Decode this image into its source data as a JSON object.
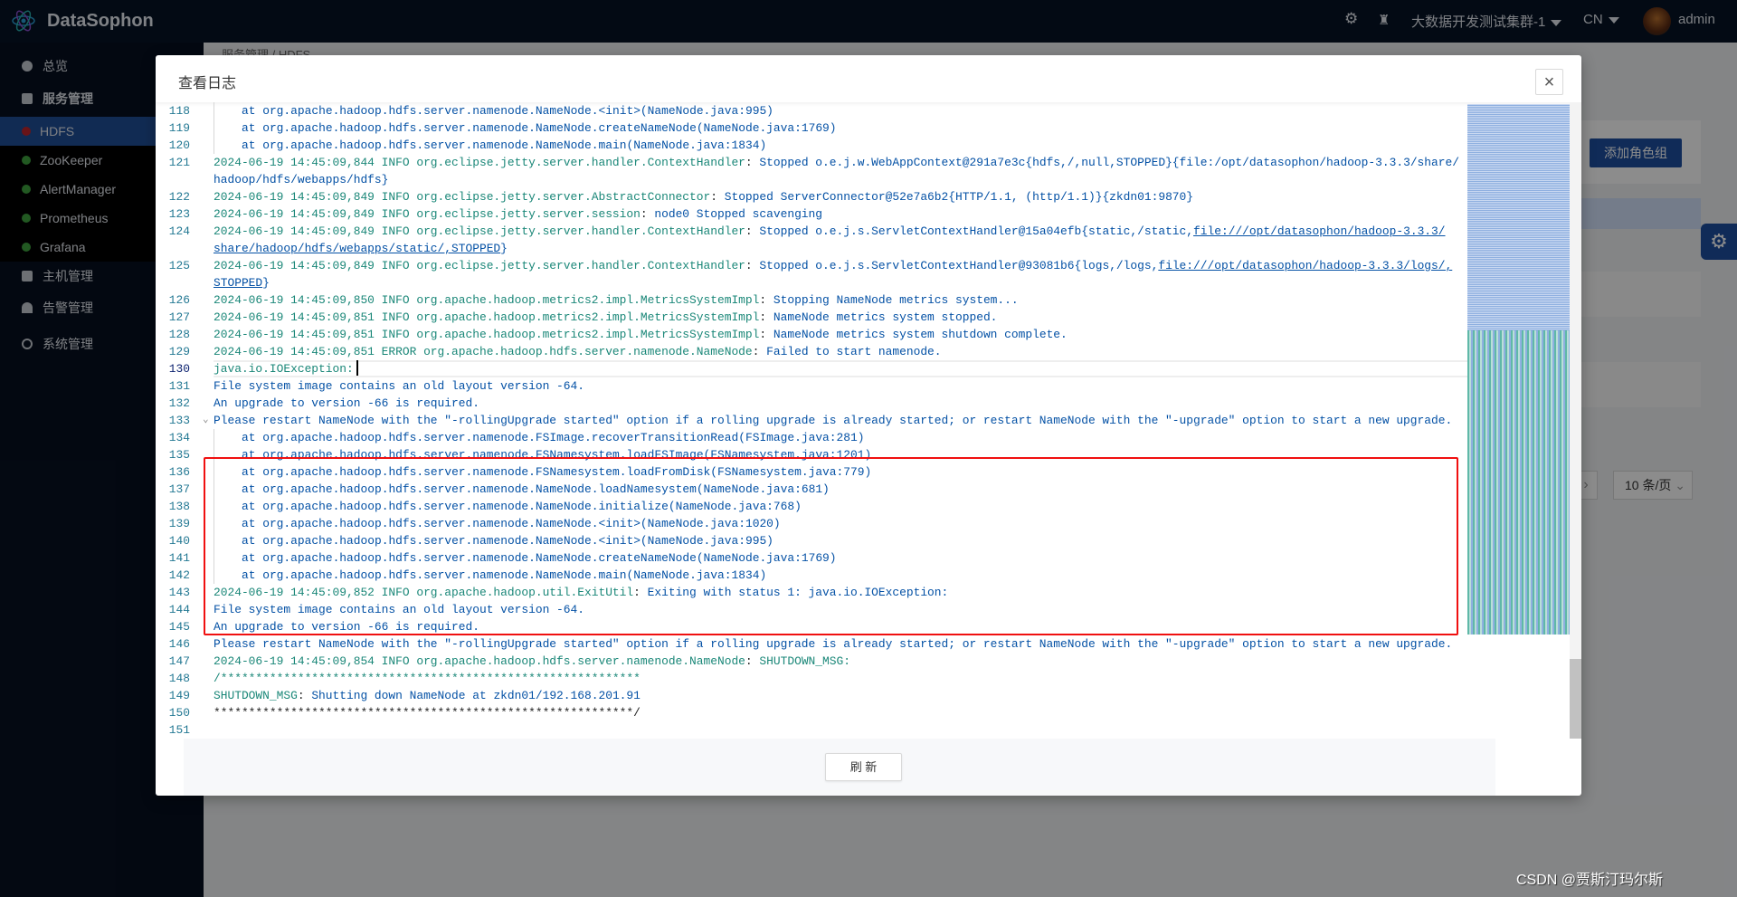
{
  "app": {
    "brand": "DataSophon",
    "cluster": "大数据开发测试集群-1",
    "lang": "CN",
    "user": "admin"
  },
  "sidebar": {
    "items": [
      {
        "label": "总览",
        "icon": "pie-chart-icon"
      },
      {
        "label": "服务管理",
        "icon": "apps-icon"
      },
      {
        "label": "HDFS",
        "status": "red"
      },
      {
        "label": "ZooKeeper",
        "status": "green"
      },
      {
        "label": "AlertManager",
        "status": "green"
      },
      {
        "label": "Prometheus",
        "status": "green"
      },
      {
        "label": "Grafana",
        "status": "green"
      },
      {
        "label": "主机管理",
        "icon": "server-icon"
      },
      {
        "label": "告警管理",
        "icon": "alarm-icon"
      },
      {
        "label": "系统管理",
        "icon": "gear-icon"
      }
    ]
  },
  "background": {
    "breadcrumb": "服务管理  /  HDFS",
    "add_role_group": "添加角色组",
    "page_size": "10 条/页"
  },
  "modal": {
    "title": "查看日志",
    "close": "×",
    "refresh": "刷 新"
  },
  "log": [
    {
      "n": 118,
      "ind": true,
      "s": [
        [
          "b",
          "at org.apache.hadoop.hdfs.server.namenode.NameNode.<init>(NameNode.java:995)"
        ]
      ]
    },
    {
      "n": 119,
      "ind": true,
      "s": [
        [
          "b",
          "at org.apache.hadoop.hdfs.server.namenode.NameNode.createNameNode(NameNode.java:1769)"
        ]
      ]
    },
    {
      "n": 120,
      "ind": true,
      "s": [
        [
          "b",
          "at org.apache.hadoop.hdfs.server.namenode.NameNode.main(NameNode.java:1834)"
        ]
      ]
    },
    {
      "n": 121,
      "s": [
        [
          "t",
          "2024-06-19 14:45:09,844 INFO org.eclipse.jetty.server.handler.ContextHandler"
        ],
        [
          "k",
          ": "
        ],
        [
          "b",
          "Stopped o.e.j.w.WebAppContext@291a7e3c{hdfs,/,null,STOPPED}{file:/opt/datasophon/hadoop-3.3.3/share/"
        ],
        [
          "br",
          ""
        ],
        [
          "b",
          "hadoop/hdfs/webapps/hdfs}"
        ]
      ]
    },
    {
      "n": 122,
      "s": [
        [
          "t",
          "2024-06-19 14:45:09,849 INFO org.eclipse.jetty.server.AbstractConnector"
        ],
        [
          "k",
          ": "
        ],
        [
          "b",
          "Stopped ServerConnector@52e7a6b2{HTTP/1.1, (http/1.1)}{zkdn01:9870}"
        ]
      ]
    },
    {
      "n": 123,
      "s": [
        [
          "t",
          "2024-06-19 14:45:09,849 INFO org.eclipse.jetty.server.session"
        ],
        [
          "k",
          ": "
        ],
        [
          "b",
          "node0 Stopped scavenging"
        ]
      ]
    },
    {
      "n": 124,
      "s": [
        [
          "t",
          "2024-06-19 14:45:09,849 INFO org.eclipse.jetty.server.handler.ContextHandler"
        ],
        [
          "k",
          ": "
        ],
        [
          "b",
          "Stopped o.e.j.s.ServletContextHandler@15a04efb{static,/static,"
        ],
        [
          "l",
          "file:///opt/datasophon/hadoop-3.3.3/"
        ],
        [
          "br",
          ""
        ],
        [
          "l",
          "share/hadoop/hdfs/webapps/static/,STOPPED"
        ],
        [
          "b",
          "}"
        ]
      ]
    },
    {
      "n": 125,
      "s": [
        [
          "t",
          "2024-06-19 14:45:09,849 INFO org.eclipse.jetty.server.handler.ContextHandler"
        ],
        [
          "k",
          ": "
        ],
        [
          "b",
          "Stopped o.e.j.s.ServletContextHandler@93081b6{logs,/logs,"
        ],
        [
          "l",
          "file:///opt/datasophon/hadoop-3.3.3/logs/,"
        ],
        [
          "br",
          ""
        ],
        [
          "l",
          "STOPPED"
        ],
        [
          "b",
          "}"
        ]
      ]
    },
    {
      "n": 126,
      "s": [
        [
          "t",
          "2024-06-19 14:45:09,850 INFO org.apache.hadoop.metrics2.impl.MetricsSystemImpl"
        ],
        [
          "k",
          ": "
        ],
        [
          "b",
          "Stopping NameNode metrics system..."
        ]
      ]
    },
    {
      "n": 127,
      "s": [
        [
          "t",
          "2024-06-19 14:45:09,851 INFO org.apache.hadoop.metrics2.impl.MetricsSystemImpl"
        ],
        [
          "k",
          ": "
        ],
        [
          "b",
          "NameNode metrics system stopped."
        ]
      ]
    },
    {
      "n": 128,
      "s": [
        [
          "t",
          "2024-06-19 14:45:09,851 INFO org.apache.hadoop.metrics2.impl.MetricsSystemImpl"
        ],
        [
          "k",
          ": "
        ],
        [
          "b",
          "NameNode metrics system shutdown complete."
        ]
      ]
    },
    {
      "n": 129,
      "s": [
        [
          "t",
          "2024-06-19 14:45:09,851 ERROR org.apache.hadoop.hdfs.server.namenode.NameNode"
        ],
        [
          "k",
          ": "
        ],
        [
          "b",
          "Failed to start namenode."
        ]
      ]
    },
    {
      "n": 130,
      "cur": true,
      "s": [
        [
          "t",
          "java.io.IOException:"
        ]
      ]
    },
    {
      "n": 131,
      "s": [
        [
          "b",
          "File system image contains an old layout version -64."
        ]
      ]
    },
    {
      "n": 132,
      "s": [
        [
          "b",
          "An upgrade to version -66 is required."
        ]
      ]
    },
    {
      "n": 133,
      "fold": true,
      "s": [
        [
          "b",
          "Please restart NameNode with the \"-rollingUpgrade started\" option if a rolling upgrade is already started; or restart NameNode with the \"-upgrade\" option to start a new upgrade."
        ]
      ]
    },
    {
      "n": 134,
      "ind": true,
      "s": [
        [
          "b",
          "at org.apache.hadoop.hdfs.server.namenode.FSImage.recoverTransitionRead(FSImage.java:281)"
        ]
      ]
    },
    {
      "n": 135,
      "ind": true,
      "s": [
        [
          "b",
          "at org.apache.hadoop.hdfs.server.namenode.FSNamesystem.loadFSImage(FSNamesystem.java:1201)"
        ]
      ]
    },
    {
      "n": 136,
      "ind": true,
      "s": [
        [
          "b",
          "at org.apache.hadoop.hdfs.server.namenode.FSNamesystem.loadFromDisk(FSNamesystem.java:779)"
        ]
      ]
    },
    {
      "n": 137,
      "ind": true,
      "s": [
        [
          "b",
          "at org.apache.hadoop.hdfs.server.namenode.NameNode.loadNamesystem(NameNode.java:681)"
        ]
      ]
    },
    {
      "n": 138,
      "ind": true,
      "s": [
        [
          "b",
          "at org.apache.hadoop.hdfs.server.namenode.NameNode.initialize(NameNode.java:768)"
        ]
      ]
    },
    {
      "n": 139,
      "ind": true,
      "s": [
        [
          "b",
          "at org.apache.hadoop.hdfs.server.namenode.NameNode.<init>(NameNode.java:1020)"
        ]
      ]
    },
    {
      "n": 140,
      "ind": true,
      "s": [
        [
          "b",
          "at org.apache.hadoop.hdfs.server.namenode.NameNode.<init>(NameNode.java:995)"
        ]
      ]
    },
    {
      "n": 141,
      "ind": true,
      "s": [
        [
          "b",
          "at org.apache.hadoop.hdfs.server.namenode.NameNode.createNameNode(NameNode.java:1769)"
        ]
      ]
    },
    {
      "n": 142,
      "ind": true,
      "s": [
        [
          "b",
          "at org.apache.hadoop.hdfs.server.namenode.NameNode.main(NameNode.java:1834)"
        ]
      ]
    },
    {
      "n": 143,
      "s": [
        [
          "t",
          "2024-06-19 14:45:09,852 INFO org.apache.hadoop.util.ExitUtil"
        ],
        [
          "k",
          ": "
        ],
        [
          "b",
          "Exiting with status 1: java.io.IOException:"
        ]
      ]
    },
    {
      "n": 144,
      "s": [
        [
          "b",
          "File system image contains an old layout version -64."
        ]
      ]
    },
    {
      "n": 145,
      "s": [
        [
          "b",
          "An upgrade to version -66 is required."
        ]
      ]
    },
    {
      "n": 146,
      "s": [
        [
          "b",
          "Please restart NameNode with the \"-rollingUpgrade started\" option if a rolling upgrade is already started; or restart NameNode with the \"-upgrade\" option to start a new upgrade."
        ]
      ]
    },
    {
      "n": 147,
      "s": [
        [
          "t",
          "2024-06-19 14:45:09,854 INFO org.apache.hadoop.hdfs.server.namenode.NameNode"
        ],
        [
          "k",
          ": "
        ],
        [
          "t",
          "SHUTDOWN_MSG:"
        ]
      ]
    },
    {
      "n": 148,
      "s": [
        [
          "t",
          "/************************************************************"
        ]
      ]
    },
    {
      "n": 149,
      "s": [
        [
          "t",
          "SHUTDOWN_MSG"
        ],
        [
          "k",
          ": "
        ],
        [
          "b",
          "Shutting down NameNode at zkdn01/192.168.201.91"
        ]
      ]
    },
    {
      "n": 150,
      "s": [
        [
          "k",
          "************************************************************/"
        ]
      ]
    },
    {
      "n": 151,
      "s": []
    }
  ],
  "colors": {
    "highlight_box": "#f01010",
    "timestamp": "#1a8778",
    "message": "#0451a5",
    "active_menu": "#1f4f98"
  },
  "watermark": "CSDN @贾斯汀玛尔斯"
}
